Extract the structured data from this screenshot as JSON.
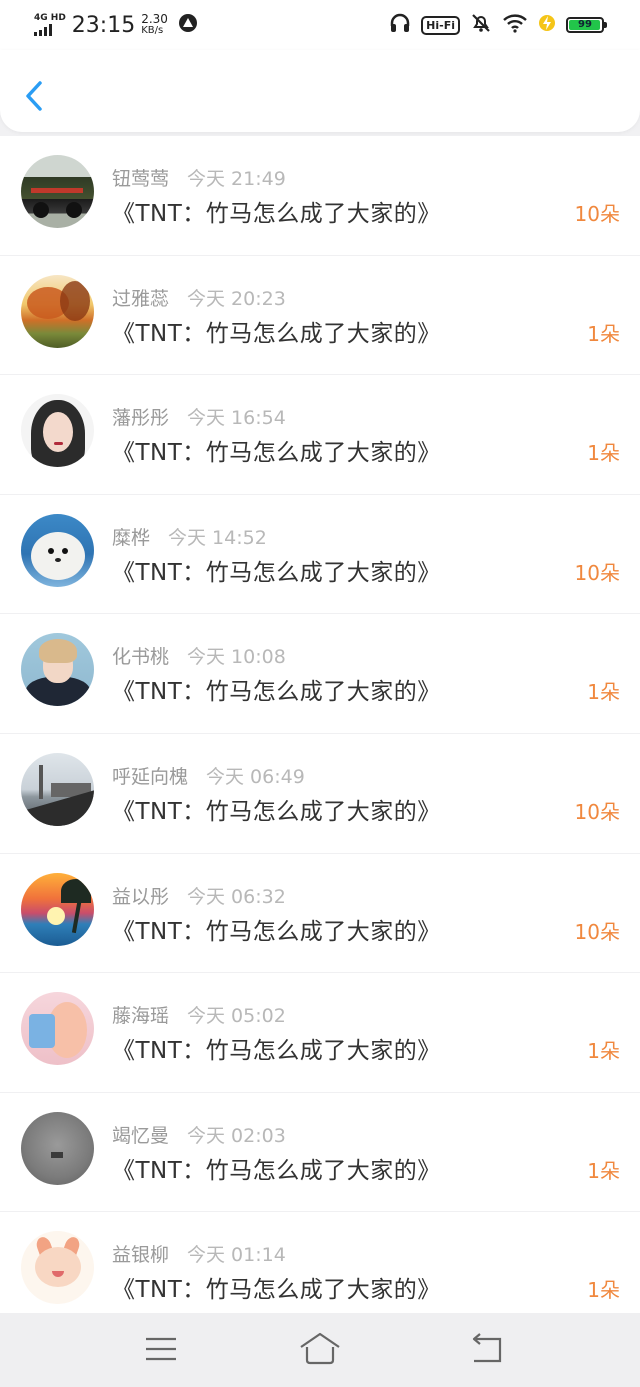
{
  "status_bar": {
    "network": "4G HD",
    "time": "23:15",
    "speed_value": "2.30",
    "speed_unit": "KB/s",
    "hifi_label": "Hi-Fi",
    "battery_level": "99",
    "battery_color": "#22c54a"
  },
  "colors": {
    "accent_back": "#2a9df4",
    "amount": "#f0883e"
  },
  "header": {
    "back_icon": "chevron-left-icon"
  },
  "list": [
    {
      "name": "钮莺莺",
      "time": "今天 21:49",
      "title": "《TNT：竹马怎么成了大家的》",
      "amount": "10朵",
      "avatar": "jeep"
    },
    {
      "name": "过雅蕊",
      "time": "今天 20:23",
      "title": "《TNT：竹马怎么成了大家的》",
      "amount": "1朵",
      "avatar": "autumn"
    },
    {
      "name": "藩彤彤",
      "time": "今天 16:54",
      "title": "《TNT：竹马怎么成了大家的》",
      "amount": "1朵",
      "avatar": "girl"
    },
    {
      "name": "糜桦",
      "time": "今天 14:52",
      "title": "《TNT：竹马怎么成了大家的》",
      "amount": "10朵",
      "avatar": "seal"
    },
    {
      "name": "化书桃",
      "time": "今天 10:08",
      "title": "《TNT：竹马怎么成了大家的》",
      "amount": "1朵",
      "avatar": "boy"
    },
    {
      "name": "呼延向槐",
      "time": "今天 06:49",
      "title": "《TNT：竹马怎么成了大家的》",
      "amount": "10朵",
      "avatar": "city"
    },
    {
      "name": "益以彤",
      "time": "今天 06:32",
      "title": "《TNT：竹马怎么成了大家的》",
      "amount": "10朵",
      "avatar": "sunset"
    },
    {
      "name": "藤海瑶",
      "time": "今天 05:02",
      "title": "《TNT：竹马怎么成了大家的》",
      "amount": "1朵",
      "avatar": "pink"
    },
    {
      "name": "竭忆曼",
      "time": "今天 02:03",
      "title": "《TNT：竹马怎么成了大家的》",
      "amount": "1朵",
      "avatar": "gray"
    },
    {
      "name": "益银柳",
      "time": "今天 01:14",
      "title": "《TNT：竹马怎么成了大家的》",
      "amount": "1朵",
      "avatar": "fox"
    }
  ],
  "nav_bar": {
    "menu_icon": "menu-icon",
    "home_icon": "home-icon",
    "back_icon": "back-return-icon"
  }
}
